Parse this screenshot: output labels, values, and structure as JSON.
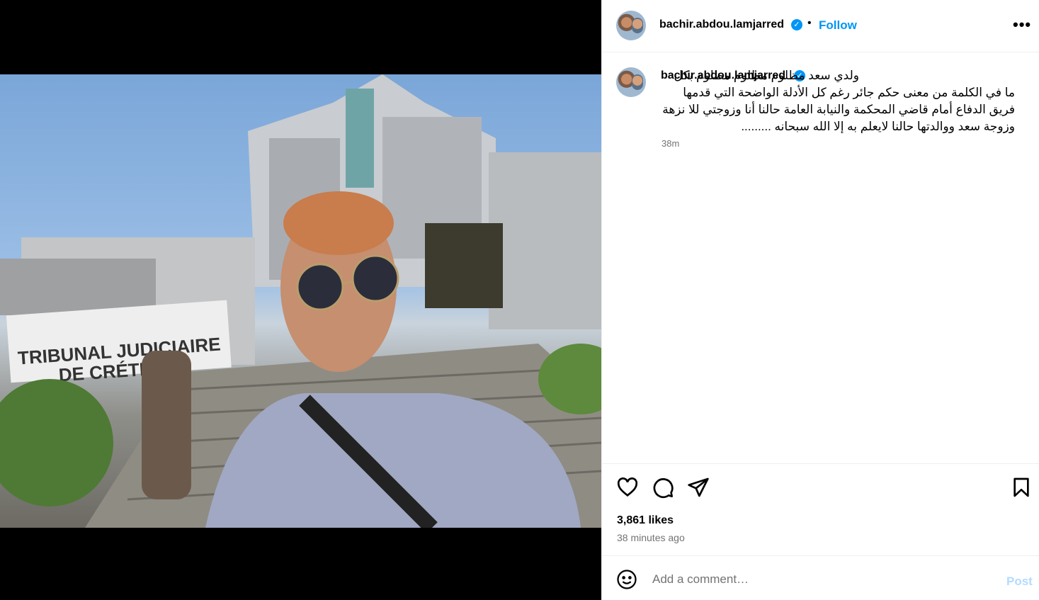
{
  "colors": {
    "accent": "#0095f6",
    "muted": "#737373",
    "post_disabled": "#b3dbff"
  },
  "post": {
    "sign_text_line1": "TRIBUNAL JUDICIAIRE",
    "sign_text_line2": "DE CRÉTEIL"
  },
  "header": {
    "username": "bachir.abdou.lamjarred",
    "verified_icon": "verified-badge-icon",
    "separator": "•",
    "follow_label": "Follow",
    "more_icon": "more-options-icon",
    "more_label": "•••"
  },
  "caption": {
    "username": "bachir.abdou.lamjarred",
    "text": "ولدي سعد مظلوم مظلوم مظلوم بكل ما في الكلمة من معنى حكم جائر رغم كل الأدلة الواضحة التي قدمها فريق الدفاع أمام قاضي المحكمة والنيابة العامة حالنا أنا وزوجتي للا نزهة وزوجة سعد ووالدتها حالنا لايعلم به إلا الله سبحانه .........",
    "time": "38m"
  },
  "actions": {
    "like_icon": "heart-icon",
    "comment_icon": "comment-icon",
    "share_icon": "share-icon",
    "save_icon": "bookmark-icon"
  },
  "stats": {
    "likes": "3,861 likes",
    "posted_ago": "38 minutes ago"
  },
  "comment": {
    "emoji_icon": "emoji-icon",
    "placeholder": "Add a comment…",
    "post_label": "Post"
  }
}
